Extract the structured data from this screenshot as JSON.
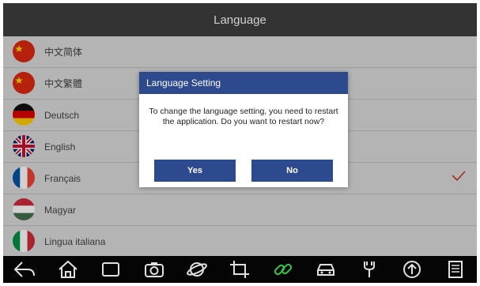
{
  "header": {
    "title": "Language"
  },
  "languages": [
    {
      "label": "中文简体",
      "flag": "china-flag-icon",
      "selected": false
    },
    {
      "label": "中文繁體",
      "flag": "china-flag-icon",
      "selected": false
    },
    {
      "label": "Deutsch",
      "flag": "germany-flag-icon",
      "selected": false
    },
    {
      "label": "English",
      "flag": "uk-flag-icon",
      "selected": false
    },
    {
      "label": "Français",
      "flag": "france-flag-icon",
      "selected": true
    },
    {
      "label": "Magyar",
      "flag": "hungary-flag-icon",
      "selected": false
    },
    {
      "label": "Lingua italiana",
      "flag": "italy-flag-icon",
      "selected": false
    }
  ],
  "dialog": {
    "title": "Language Setting",
    "message": "To change the language setting, you need to restart the application. Do you want to restart now?",
    "yes_label": "Yes",
    "no_label": "No"
  },
  "toolbar": {
    "icons": [
      "back-icon",
      "home-icon",
      "window-icon",
      "camera-icon",
      "browser-icon",
      "crop-icon",
      "link-icon",
      "car-icon",
      "wrench-icon",
      "upload-icon",
      "document-icon"
    ]
  },
  "colors": {
    "header_bg": "#333333",
    "dialog_accent": "#2e4a8e",
    "check": "#c0392b",
    "link_icon": "#2ecc40"
  }
}
